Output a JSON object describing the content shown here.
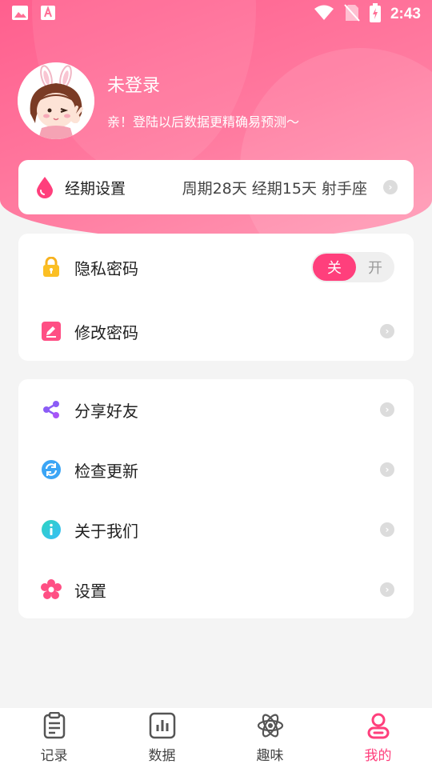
{
  "status_bar": {
    "time": "2:43",
    "icons": [
      "image-icon",
      "font-icon",
      "wifi-icon",
      "no-sim-icon",
      "battery-charging-icon"
    ]
  },
  "profile": {
    "name": "未登录",
    "subtitle": "亲！登陆以后数据更精确易预测～"
  },
  "period": {
    "title": "经期设置",
    "info": "周期28天 经期15天 射手座"
  },
  "security": {
    "privacy_label": "隐私密码",
    "toggle_off": "关",
    "toggle_on": "开",
    "toggle_state": "off",
    "change_password_label": "修改密码"
  },
  "menu": {
    "share": "分享好友",
    "update": "检查更新",
    "about": "关于我们",
    "settings": "设置"
  },
  "nav": {
    "items": [
      {
        "label": "记录",
        "icon": "clipboard-icon"
      },
      {
        "label": "数据",
        "icon": "bar-chart-icon"
      },
      {
        "label": "趣味",
        "icon": "atom-icon"
      },
      {
        "label": "我的",
        "icon": "user-icon",
        "active": true
      }
    ]
  },
  "colors": {
    "accent": "#ff3f7c",
    "header_gradient_start": "#ff5f8e",
    "header_gradient_end": "#ff9ab5"
  }
}
